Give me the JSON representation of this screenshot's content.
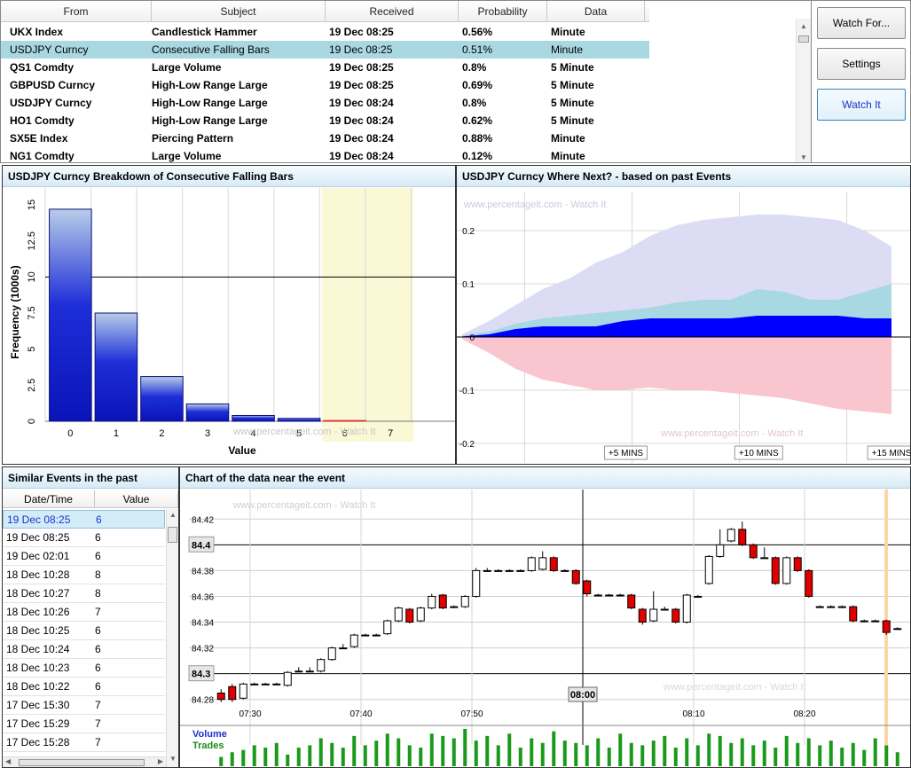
{
  "alerts": {
    "columns": [
      "From",
      "Subject",
      "Received",
      "Probability",
      "Data"
    ],
    "rows": [
      {
        "from": "UKX Index",
        "subject": "Candlestick Hammer",
        "received": "19 Dec 08:25",
        "probability": "0.56%",
        "data": "Minute"
      },
      {
        "from": "USDJPY Curncy",
        "subject": "Consecutive Falling Bars",
        "received": "19 Dec 08:25",
        "probability": "0.51%",
        "data": "Minute"
      },
      {
        "from": "QS1 Comdty",
        "subject": "Large Volume",
        "received": "19 Dec 08:25",
        "probability": "0.8%",
        "data": "5 Minute"
      },
      {
        "from": "GBPUSD Curncy",
        "subject": "High-Low Range Large",
        "received": "19 Dec 08:25",
        "probability": "0.69%",
        "data": "5 Minute"
      },
      {
        "from": "USDJPY Curncy",
        "subject": "High-Low Range Large",
        "received": "19 Dec 08:24",
        "probability": "0.8%",
        "data": "5 Minute"
      },
      {
        "from": "HO1 Comdty",
        "subject": "High-Low Range Large",
        "received": "19 Dec 08:24",
        "probability": "0.62%",
        "data": "5 Minute"
      },
      {
        "from": "SX5E Index",
        "subject": "Piercing Pattern",
        "received": "19 Dec 08:24",
        "probability": "0.88%",
        "data": "Minute"
      },
      {
        "from": "NG1 Comdty",
        "subject": "Large Volume",
        "received": "19 Dec 08:24",
        "probability": "0.12%",
        "data": "Minute"
      }
    ],
    "selected_index": 1
  },
  "buttons": {
    "watch_for": "Watch For...",
    "settings": "Settings",
    "watch_it": "Watch It"
  },
  "breakdown": {
    "title": "USDJPY Curncy Breakdown of Consecutive Falling Bars",
    "watermark": "www.percentageit.com - Watch It"
  },
  "wherenext": {
    "title": "USDJPY Curncy Where Next? - based on past Events",
    "watermark": "www.percentageit.com - Watch It",
    "time_labels": [
      "+5 MINS",
      "+10 MINS",
      "+15 MINS"
    ]
  },
  "similar": {
    "title": "Similar Events in the past",
    "columns": [
      "Date/Time",
      "Value"
    ],
    "rows": [
      {
        "dt": "19 Dec 08:25",
        "value": "6"
      },
      {
        "dt": "19 Dec 08:25",
        "value": "6"
      },
      {
        "dt": "19 Dec 02:01",
        "value": "6"
      },
      {
        "dt": "18 Dec 10:28",
        "value": "8"
      },
      {
        "dt": "18 Dec 10:27",
        "value": "8"
      },
      {
        "dt": "18 Dec 10:26",
        "value": "7"
      },
      {
        "dt": "18 Dec 10:25",
        "value": "6"
      },
      {
        "dt": "18 Dec 10:24",
        "value": "6"
      },
      {
        "dt": "18 Dec 10:23",
        "value": "6"
      },
      {
        "dt": "18 Dec 10:22",
        "value": "6"
      },
      {
        "dt": "17 Dec 15:30",
        "value": "7"
      },
      {
        "dt": "17 Dec 15:29",
        "value": "7"
      },
      {
        "dt": "17 Dec 15:28",
        "value": "7"
      }
    ],
    "selected_index": 0
  },
  "neardata": {
    "title": "Chart of the data near the event",
    "watermark": "www.percentageit.com - Watch It",
    "event_time_label": "08:00",
    "volume_label": "Volume",
    "trades_label": "Trades"
  },
  "colors": {
    "up": "#ffffff",
    "down": "#e00000",
    "bar_blue": "#0b1fd0",
    "volume_green": "#1a9a1a",
    "selected_row": "#a9d8e2"
  },
  "chart_data": [
    {
      "type": "bar",
      "title": "USDJPY Curncy Breakdown of Consecutive Falling Bars",
      "xlabel": "Value",
      "ylabel": "Frequency (1000s)",
      "categories": [
        "0",
        "1",
        "2",
        "3",
        "4",
        "5",
        "6",
        "7"
      ],
      "values": [
        14.7,
        7.5,
        3.1,
        1.2,
        0.4,
        0.2,
        0.05,
        0
      ],
      "ylim": [
        0,
        15
      ],
      "yticks": [
        "0",
        "2.5",
        "5",
        "7.5",
        "10",
        "12.5",
        "15"
      ],
      "highlight_categories": [
        "6",
        "7"
      ],
      "reference_line": 10
    },
    {
      "type": "area",
      "title": "USDJPY Curncy Where Next? - based on past Events",
      "x_ticks": [
        "+5 MINS",
        "+10 MINS",
        "+15 MINS"
      ],
      "y_ticks": [
        "0.2",
        "0.1",
        "0",
        "-0.1",
        "-0.2"
      ],
      "ylim": [
        -0.2,
        0.2
      ],
      "steps": 16,
      "series": [
        {
          "color": "#dcdcf4",
          "values_upper": [
            0.005,
            0.03,
            0.06,
            0.09,
            0.11,
            0.14,
            0.16,
            0.19,
            0.21,
            0.22,
            0.225,
            0.23,
            0.23,
            0.225,
            0.22,
            0.2,
            0.17
          ]
        },
        {
          "color": "#a8d8e2",
          "values_upper": [
            0.003,
            0.01,
            0.025,
            0.035,
            0.04,
            0.045,
            0.05,
            0.055,
            0.065,
            0.07,
            0.07,
            0.09,
            0.085,
            0.07,
            0.07,
            0.085,
            0.1
          ]
        },
        {
          "color": "#0000ff",
          "values_upper": [
            0.001,
            0.005,
            0.015,
            0.02,
            0.02,
            0.02,
            0.03,
            0.035,
            0.035,
            0.035,
            0.035,
            0.04,
            0.04,
            0.04,
            0.04,
            0.035,
            0.035
          ]
        },
        {
          "color": "#ff0000",
          "values_lower": [
            -0.001,
            -0.005,
            -0.02,
            -0.02,
            -0.02,
            -0.02,
            -0.025,
            -0.025,
            -0.025,
            -0.025,
            -0.025,
            -0.025,
            -0.025,
            -0.025,
            -0.025,
            -0.025,
            -0.025
          ]
        },
        {
          "color": "#f9c6cf",
          "values_lower": [
            -0.004,
            -0.03,
            -0.06,
            -0.08,
            -0.09,
            -0.1,
            -0.1,
            -0.095,
            -0.1,
            -0.1,
            -0.105,
            -0.11,
            -0.115,
            -0.125,
            -0.135,
            -0.14,
            -0.145
          ]
        }
      ]
    },
    {
      "type": "candlestick",
      "title": "Chart of the data near the event",
      "x_ticks": [
        "07:30",
        "07:40",
        "07:50",
        "08:00",
        "08:10",
        "08:20"
      ],
      "y_ticks": [
        "84.42",
        "84.4",
        "84.38",
        "84.36",
        "84.34",
        "84.32",
        "84.3",
        "84.28"
      ],
      "ylim": [
        84.275,
        84.425
      ],
      "event_time": "08:00",
      "candles": [
        {
          "o": 84.285,
          "c": 84.28,
          "h": 84.288,
          "l": 84.278
        },
        {
          "o": 84.29,
          "c": 84.28,
          "h": 84.292,
          "l": 84.278
        },
        {
          "o": 84.281,
          "c": 84.292,
          "h": 84.293,
          "l": 84.28
        },
        {
          "o": 84.292,
          "c": 84.292,
          "h": 84.293,
          "l": 84.292
        },
        {
          "o": 84.292,
          "c": 84.292,
          "h": 84.293,
          "l": 84.292
        },
        {
          "o": 84.292,
          "c": 84.292,
          "h": 84.293,
          "l": 84.292
        },
        {
          "o": 84.291,
          "c": 84.301,
          "h": 84.302,
          "l": 84.29
        },
        {
          "o": 84.302,
          "c": 84.302,
          "h": 84.305,
          "l": 84.302
        },
        {
          "o": 84.302,
          "c": 84.302,
          "h": 84.305,
          "l": 84.302
        },
        {
          "o": 84.302,
          "c": 84.311,
          "h": 84.312,
          "l": 84.301
        },
        {
          "o": 84.311,
          "c": 84.32,
          "h": 84.321,
          "l": 84.31
        },
        {
          "o": 84.32,
          "c": 84.32,
          "h": 84.323,
          "l": 84.32
        },
        {
          "o": 84.321,
          "c": 84.33,
          "h": 84.331,
          "l": 84.32
        },
        {
          "o": 84.33,
          "c": 84.33,
          "h": 84.331,
          "l": 84.33
        },
        {
          "o": 84.33,
          "c": 84.33,
          "h": 84.331,
          "l": 84.33
        },
        {
          "o": 84.331,
          "c": 84.341,
          "h": 84.342,
          "l": 84.33
        },
        {
          "o": 84.341,
          "c": 84.351,
          "h": 84.352,
          "l": 84.34
        },
        {
          "o": 84.35,
          "c": 84.34,
          "h": 84.351,
          "l": 84.339
        },
        {
          "o": 84.341,
          "c": 84.351,
          "h": 84.352,
          "l": 84.34
        },
        {
          "o": 84.351,
          "c": 84.36,
          "h": 84.362,
          "l": 84.35
        },
        {
          "o": 84.361,
          "c": 84.351,
          "h": 84.362,
          "l": 84.35
        },
        {
          "o": 84.352,
          "c": 84.352,
          "h": 84.353,
          "l": 84.352
        },
        {
          "o": 84.352,
          "c": 84.36,
          "h": 84.361,
          "l": 84.351
        },
        {
          "o": 84.36,
          "c": 84.38,
          "h": 84.382,
          "l": 84.359
        },
        {
          "o": 84.38,
          "c": 84.38,
          "h": 84.382,
          "l": 84.38
        },
        {
          "o": 84.38,
          "c": 84.38,
          "h": 84.381,
          "l": 84.38
        },
        {
          "o": 84.38,
          "c": 84.38,
          "h": 84.381,
          "l": 84.38
        },
        {
          "o": 84.38,
          "c": 84.38,
          "h": 84.381,
          "l": 84.38
        },
        {
          "o": 84.38,
          "c": 84.39,
          "h": 84.391,
          "l": 84.379
        },
        {
          "o": 84.381,
          "c": 84.39,
          "h": 84.395,
          "l": 84.38
        },
        {
          "o": 84.39,
          "c": 84.38,
          "h": 84.391,
          "l": 84.379
        },
        {
          "o": 84.38,
          "c": 84.38,
          "h": 84.381,
          "l": 84.38
        },
        {
          "o": 84.38,
          "c": 84.37,
          "h": 84.381,
          "l": 84.369
        },
        {
          "o": 84.372,
          "c": 84.362,
          "h": 84.373,
          "l": 84.36
        },
        {
          "o": 84.361,
          "c": 84.361,
          "h": 84.362,
          "l": 84.361
        },
        {
          "o": 84.361,
          "c": 84.361,
          "h": 84.362,
          "l": 84.361
        },
        {
          "o": 84.361,
          "c": 84.361,
          "h": 84.362,
          "l": 84.361
        },
        {
          "o": 84.361,
          "c": 84.351,
          "h": 84.362,
          "l": 84.35
        },
        {
          "o": 84.35,
          "c": 84.34,
          "h": 84.351,
          "l": 84.338
        },
        {
          "o": 84.341,
          "c": 84.35,
          "h": 84.364,
          "l": 84.34
        },
        {
          "o": 84.35,
          "c": 84.35,
          "h": 84.352,
          "l": 84.35
        },
        {
          "o": 84.35,
          "c": 84.34,
          "h": 84.351,
          "l": 84.339
        },
        {
          "o": 84.34,
          "c": 84.361,
          "h": 84.362,
          "l": 84.339
        },
        {
          "o": 84.36,
          "c": 84.36,
          "h": 84.361,
          "l": 84.36
        },
        {
          "o": 84.37,
          "c": 84.391,
          "h": 84.392,
          "l": 84.369
        },
        {
          "o": 84.391,
          "c": 84.4,
          "h": 84.412,
          "l": 84.39
        },
        {
          "o": 84.403,
          "c": 84.412,
          "h": 84.413,
          "l": 84.402
        },
        {
          "o": 84.412,
          "c": 84.4,
          "h": 84.418,
          "l": 84.399
        },
        {
          "o": 84.4,
          "c": 84.39,
          "h": 84.401,
          "l": 84.389
        },
        {
          "o": 84.39,
          "c": 84.39,
          "h": 84.398,
          "l": 84.39
        },
        {
          "o": 84.39,
          "c": 84.37,
          "h": 84.391,
          "l": 84.369
        },
        {
          "o": 84.37,
          "c": 84.39,
          "h": 84.391,
          "l": 84.369
        },
        {
          "o": 84.39,
          "c": 84.38,
          "h": 84.391,
          "l": 84.379
        },
        {
          "o": 84.38,
          "c": 84.36,
          "h": 84.381,
          "l": 84.359
        },
        {
          "o": 84.352,
          "c": 84.352,
          "h": 84.353,
          "l": 84.352
        },
        {
          "o": 84.352,
          "c": 84.352,
          "h": 84.353,
          "l": 84.352
        },
        {
          "o": 84.352,
          "c": 84.352,
          "h": 84.353,
          "l": 84.352
        },
        {
          "o": 84.352,
          "c": 84.341,
          "h": 84.353,
          "l": 84.34
        },
        {
          "o": 84.341,
          "c": 84.341,
          "h": 84.342,
          "l": 84.341
        },
        {
          "o": 84.341,
          "c": 84.341,
          "h": 84.342,
          "l": 84.341
        },
        {
          "o": 84.341,
          "c": 84.332,
          "h": 84.342,
          "l": 84.33
        },
        {
          "o": 84.335,
          "c": 84.335,
          "h": 84.336,
          "l": 84.335
        }
      ],
      "volume": [
        4,
        6,
        7,
        9,
        8,
        10,
        5,
        8,
        9,
        12,
        10,
        8,
        13,
        9,
        11,
        14,
        12,
        9,
        8,
        14,
        13,
        12,
        16,
        11,
        13,
        9,
        14,
        8,
        12,
        10,
        15,
        11,
        10,
        9,
        12,
        8,
        14,
        10,
        9,
        11,
        13,
        8,
        12,
        9,
        14,
        13,
        10,
        12,
        9,
        11,
        8,
        13,
        10,
        12,
        9,
        11,
        8,
        10,
        7,
        12,
        9,
        6
      ]
    }
  ]
}
